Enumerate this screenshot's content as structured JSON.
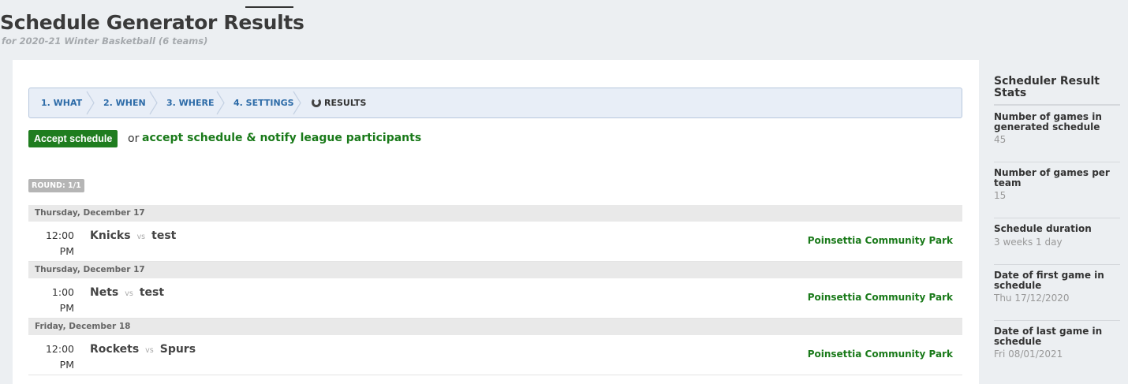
{
  "header": {
    "title": "Schedule Generator Results",
    "subtitle": "for 2020-21 Winter Basketball (6 teams)"
  },
  "steps": [
    {
      "label": "1. WHAT",
      "state": "done"
    },
    {
      "label": "2. WHEN",
      "state": "done"
    },
    {
      "label": "3. WHERE",
      "state": "done"
    },
    {
      "label": "4. SETTINGS",
      "state": "done"
    },
    {
      "label": "RESULTS",
      "state": "current"
    }
  ],
  "actions": {
    "accept_label": "Accept schedule",
    "or_text": "or",
    "notify_label": "accept schedule & notify league participants"
  },
  "round_badge": "ROUND: 1/1",
  "games": [
    {
      "date": "Thursday, December 17",
      "time_line1": "12:00",
      "time_line2": "PM",
      "home": "Knicks",
      "vs": "vs",
      "away": "test",
      "venue": "Poinsettia Community Park"
    },
    {
      "date": "Thursday, December 17",
      "time_line1": "1:00",
      "time_line2": "PM",
      "home": "Nets",
      "vs": "vs",
      "away": "test",
      "venue": "Poinsettia Community Park"
    },
    {
      "date": "Friday, December 18",
      "time_line1": "12:00",
      "time_line2": "PM",
      "home": "Rockets",
      "vs": "vs",
      "away": "Spurs",
      "venue": "Poinsettia Community Park"
    }
  ],
  "sidebar": {
    "title": "Scheduler Result Stats",
    "stats": [
      {
        "label": "Number of games in generated schedule",
        "value": "45"
      },
      {
        "label": "Number of games per team",
        "value": "15"
      },
      {
        "label": "Schedule duration",
        "value": "3 weeks 1 day"
      },
      {
        "label": "Date of first game in schedule",
        "value": "Thu 17/12/2020"
      },
      {
        "label": "Date of last game in schedule",
        "value": "Fri 08/01/2021"
      }
    ]
  },
  "colors": {
    "accent_green": "#1f7d1f",
    "link_blue": "#2e6ca8",
    "background": "#eceff2"
  },
  "icons": {
    "results_step": "refresh-icon"
  }
}
